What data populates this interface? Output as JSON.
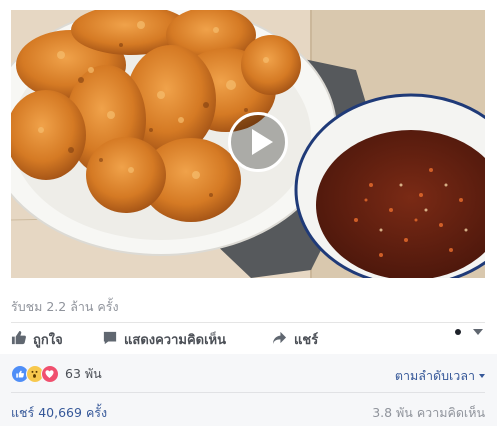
{
  "video": {
    "description_icon": "play-icon"
  },
  "stats": {
    "views": "รับชม 2.2 ล้าน ครั้ง"
  },
  "actions": {
    "like": "ถูกใจ",
    "comment": "แสดงความคิดเห็น",
    "share": "แชร์"
  },
  "reactions": {
    "count": "63 พัน",
    "sort_label": "ตามลำดับเวลา",
    "shares": "แชร์ 40,669 ครั้ง",
    "comments": "3.8 พัน ความคิดเห็น"
  },
  "colors": {
    "link": "#365899",
    "muted": "#90949c",
    "panel": "#f6f7f9",
    "like_blue": "#4f8ef7",
    "wow_yellow": "#f7c84d",
    "love_red": "#f0506e"
  }
}
